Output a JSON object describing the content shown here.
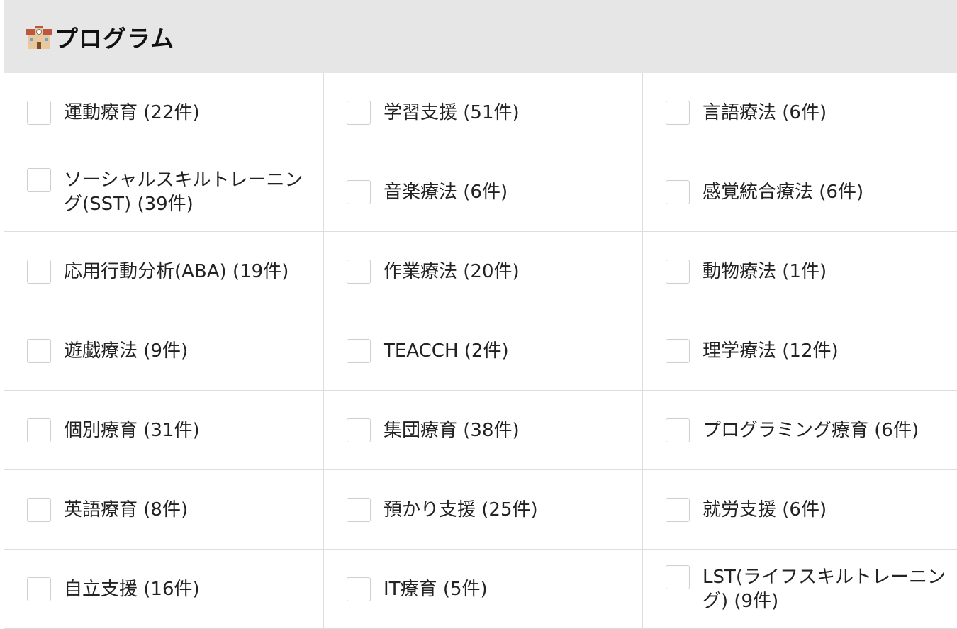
{
  "section": {
    "icon": "school-icon",
    "title": "プログラム"
  },
  "options": [
    {
      "label": "運動療育 (22件)",
      "checked": false
    },
    {
      "label": "学習支援 (51件)",
      "checked": false
    },
    {
      "label": "言語療法 (6件)",
      "checked": false
    },
    {
      "label": "ソーシャルスキルトレーニング(SST) (39件)",
      "checked": false
    },
    {
      "label": "音楽療法 (6件)",
      "checked": false
    },
    {
      "label": "感覚統合療法 (6件)",
      "checked": false
    },
    {
      "label": "応用行動分析(ABA) (19件)",
      "checked": false
    },
    {
      "label": "作業療法 (20件)",
      "checked": false
    },
    {
      "label": "動物療法 (1件)",
      "checked": false
    },
    {
      "label": "遊戯療法 (9件)",
      "checked": false
    },
    {
      "label": "TEACCH (2件)",
      "checked": false
    },
    {
      "label": "理学療法 (12件)",
      "checked": false
    },
    {
      "label": "個別療育 (31件)",
      "checked": false
    },
    {
      "label": "集団療育 (38件)",
      "checked": false
    },
    {
      "label": "プログラミング療育 (6件)",
      "checked": false
    },
    {
      "label": "英語療育 (8件)",
      "checked": false
    },
    {
      "label": "預かり支援 (25件)",
      "checked": false
    },
    {
      "label": "就労支援 (6件)",
      "checked": false
    },
    {
      "label": "自立支援 (16件)",
      "checked": false
    },
    {
      "label": "IT療育 (5件)",
      "checked": false
    },
    {
      "label": "LST(ライフスキルトレーニング) (9件)",
      "checked": false
    }
  ]
}
